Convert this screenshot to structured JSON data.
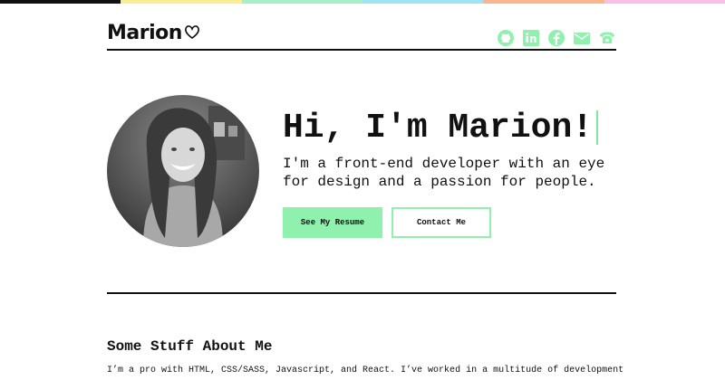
{
  "top_stripe_colors": [
    "#111111",
    "#f9ee93",
    "#a8eec7",
    "#9fe3f5",
    "#f8b58e",
    "#f5bfe8"
  ],
  "accent_color": "#90f0ad",
  "header": {
    "logo_text": "Marion",
    "logo_icon": "heart-icon",
    "social_icons": [
      "github-icon",
      "linkedin-icon",
      "facebook-icon",
      "email-icon",
      "phone-icon"
    ]
  },
  "hero": {
    "greeting": "Hi, I'm Marion!",
    "tagline": "I'm a front-end developer with an eye for design and a passion for people.",
    "primary_button": "See My Resume",
    "secondary_button": "Contact Me"
  },
  "about": {
    "title": "Some Stuff About Me",
    "body": "I’m a pro with HTML, CSS/SASS, Javascript, and React. I’ve worked in a multitude of development"
  }
}
